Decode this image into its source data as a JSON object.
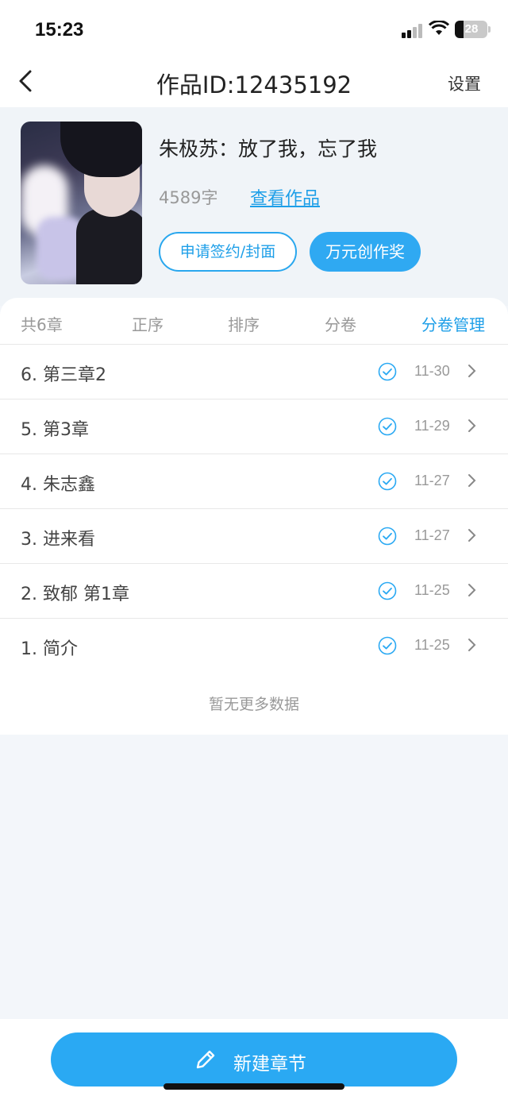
{
  "status_bar": {
    "time": "15:23",
    "battery": "28"
  },
  "nav": {
    "title": "作品ID:12435192",
    "settings": "设置"
  },
  "work": {
    "title": "朱极苏：放了我，忘了我",
    "word_count": "4589字",
    "view_link": "查看作品",
    "apply_button": "申请签约/封面",
    "award_button": "万元创作奖"
  },
  "toolbar": {
    "total": "共6章",
    "order": "正序",
    "sort": "排序",
    "volume": "分卷",
    "volume_manage": "分卷管理"
  },
  "chapters": [
    {
      "name": "6. 第三章2",
      "date": "11-30"
    },
    {
      "name": "5. 第3章",
      "date": "11-29"
    },
    {
      "name": "4. 朱志鑫",
      "date": "11-27"
    },
    {
      "name": "3. 进来看",
      "date": "11-27"
    },
    {
      "name": "2. 致郁 第1章",
      "date": "11-25"
    },
    {
      "name": "1. 简介",
      "date": "11-25"
    }
  ],
  "no_more": "暂无更多数据",
  "new_chapter_button": "新建章节",
  "colors": {
    "accent": "#2aa9f3",
    "link": "#1e9fe8",
    "background": "#f3f6fa"
  }
}
